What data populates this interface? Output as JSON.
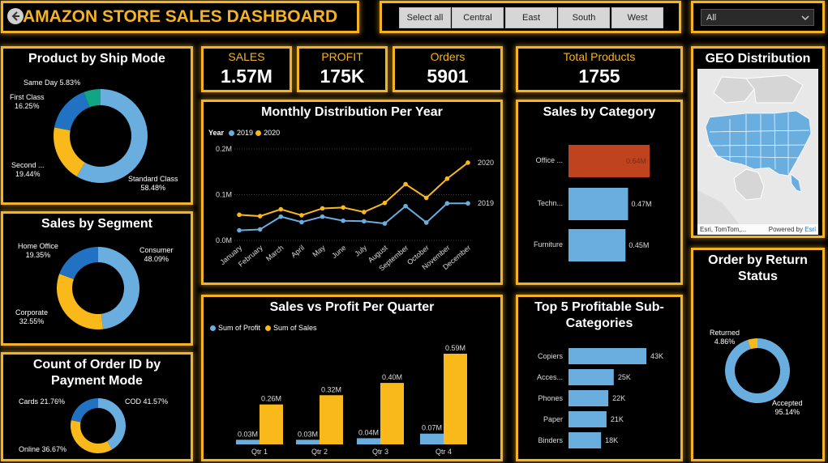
{
  "header": {
    "title": "AMAZON STORE SALES DASHBOARD",
    "back_icon": "back-arrow-icon"
  },
  "region_slicer": {
    "options": [
      "Select all",
      "Central",
      "East",
      "South",
      "West"
    ]
  },
  "dropdown": {
    "value": "All",
    "icon": "chevron-down-icon"
  },
  "kpis": [
    {
      "label": "SALES",
      "value": "1.57M"
    },
    {
      "label": "PROFIT",
      "value": "175K"
    },
    {
      "label": "Orders",
      "value": "5901"
    },
    {
      "label": "Total Products",
      "value": "1755"
    }
  ],
  "colors": {
    "accent": "#f5b324",
    "blue": "#6aaee0",
    "dark_blue": "#2272c3",
    "teal": "#11a585",
    "rust": "#c0431f",
    "yellow": "#f9b91a"
  },
  "ship_mode": {
    "title": "Product by Ship Mode",
    "slices": [
      {
        "name": "Standard Class",
        "value": 58.48,
        "pct": "58.48%"
      },
      {
        "name": "Second ...",
        "value": 19.44,
        "pct": "19.44%"
      },
      {
        "name": "First Class",
        "value": 16.25,
        "pct": "16.25%"
      },
      {
        "name": "Same Day",
        "value": 5.83,
        "pct": "5.83%"
      }
    ]
  },
  "segment": {
    "title": "Sales by Segment",
    "slices": [
      {
        "name": "Consumer",
        "value": 48.09,
        "pct": "48.09%"
      },
      {
        "name": "Corporate",
        "value": 32.55,
        "pct": "32.55%"
      },
      {
        "name": "Home Office",
        "value": 19.35,
        "pct": "19.35%"
      }
    ]
  },
  "payment": {
    "title": "Count of Order ID by Payment Mode",
    "slices": [
      {
        "name": "COD",
        "value": 41.57,
        "pct": "41.57%"
      },
      {
        "name": "Online",
        "value": 36.67,
        "pct": "36.67%"
      },
      {
        "name": "Cards",
        "value": 21.76,
        "pct": "21.76%"
      }
    ]
  },
  "return_status": {
    "title": "Order by Return Status",
    "slices": [
      {
        "name": "Accepted",
        "value": 95.14,
        "pct": "95.14%"
      },
      {
        "name": "Returned",
        "value": 4.86,
        "pct": "4.86%"
      }
    ]
  },
  "geo": {
    "title": "GEO Distribution",
    "attribution": "Esri, TomTom,...",
    "powered": "Powered by",
    "powered_brand": "Esri"
  },
  "chart_data": [
    {
      "type": "line",
      "title": "Monthly Distribution Per Year",
      "legend_title": "Year",
      "x": [
        "January",
        "February",
        "March",
        "April",
        "May",
        "June",
        "July",
        "August",
        "September",
        "October",
        "November",
        "December"
      ],
      "series": [
        {
          "name": "2019",
          "values": [
            0.022,
            0.024,
            0.052,
            0.04,
            0.052,
            0.043,
            0.042,
            0.037,
            0.075,
            0.039,
            0.081,
            0.081
          ]
        },
        {
          "name": "2020",
          "values": [
            0.056,
            0.053,
            0.068,
            0.055,
            0.07,
            0.072,
            0.062,
            0.082,
            0.123,
            0.093,
            0.135,
            0.17
          ]
        }
      ],
      "y_ticks": [
        "0.0M",
        "0.1M",
        "0.2M"
      ],
      "ylim": [
        0,
        0.2
      ]
    },
    {
      "type": "bar",
      "title": "Sales by Category",
      "categories": [
        "Office ...",
        "Techn...",
        "Furniture"
      ],
      "values": [
        0.64,
        0.47,
        0.45
      ],
      "labels": [
        "0.64M",
        "0.47M",
        "0.45M"
      ]
    },
    {
      "type": "bar",
      "title": "Sales vs Profit Per Quarter",
      "categories": [
        "Qtr 1",
        "Qtr 2",
        "Qtr 3",
        "Qtr 4"
      ],
      "series": [
        {
          "name": "Sum of Profit",
          "values": [
            0.03,
            0.03,
            0.04,
            0.07
          ],
          "labels": [
            "0.03M",
            "0.03M",
            "0.04M",
            "0.07M"
          ]
        },
        {
          "name": "Sum of Sales",
          "values": [
            0.26,
            0.32,
            0.4,
            0.59
          ],
          "labels": [
            "0.26M",
            "0.32M",
            "0.40M",
            "0.59M"
          ]
        }
      ]
    },
    {
      "type": "bar",
      "title": "Top 5 Profitable Sub-Categories",
      "categories": [
        "Copiers",
        "Acces...",
        "Phones",
        "Paper",
        "Binders"
      ],
      "values": [
        43,
        25,
        22,
        21,
        18
      ],
      "labels": [
        "43K",
        "25K",
        "22K",
        "21K",
        "18K"
      ]
    }
  ]
}
